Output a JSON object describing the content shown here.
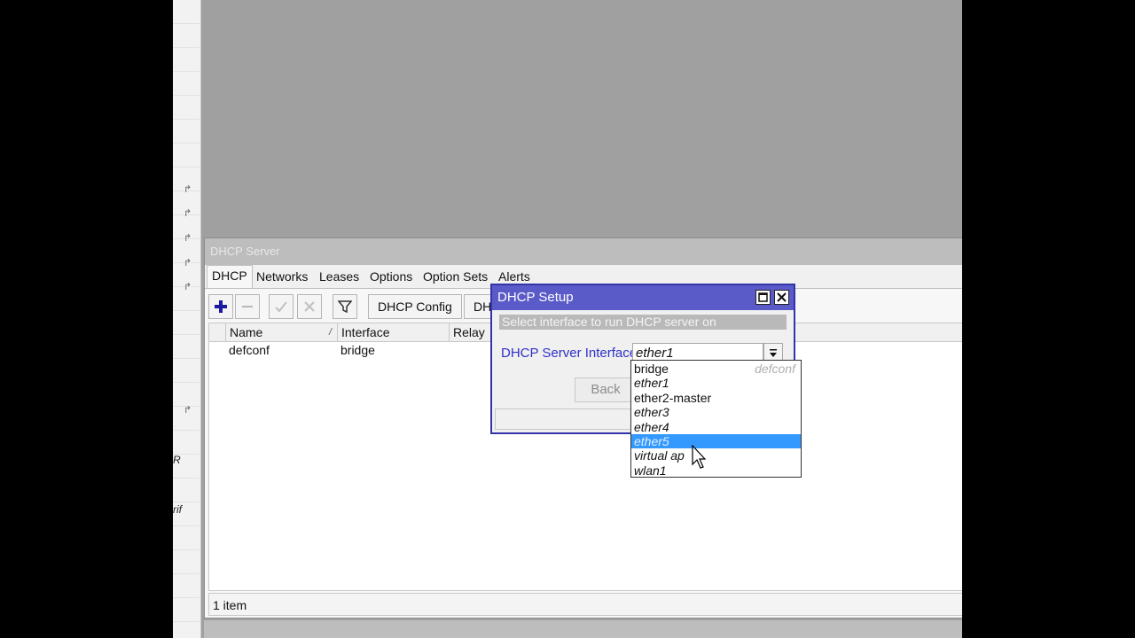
{
  "left_strip": {
    "flags": [
      "↱",
      "↱",
      "↱",
      "↱",
      "↱",
      "↱"
    ],
    "frag_1": "R",
    "frag_2": "rif"
  },
  "dhcp_window": {
    "title": "DHCP Server",
    "tabs": [
      "DHCP",
      "Networks",
      "Leases",
      "Options",
      "Option Sets",
      "Alerts"
    ],
    "toolbar": {
      "add_icon": "plus-icon",
      "remove_icon": "minus-icon",
      "enable_icon": "check-icon",
      "disable_icon": "cross-icon",
      "filter_icon": "filter-icon",
      "dhcp_config_label": "DHCP Config",
      "dhcp_setup_label": "DH"
    },
    "columns": [
      "Name",
      "Interface",
      "Relay"
    ],
    "sort_indicator": "/",
    "rows": [
      {
        "name": "defconf",
        "interface": "bridge",
        "relay": ""
      }
    ],
    "status": "1 item"
  },
  "setup_dialog": {
    "title": "DHCP Setup",
    "maximize_icon": "maximize-icon",
    "close_icon": "close-icon",
    "instruction": "Select interface to run DHCP server on",
    "field_label": "DHCP Server Interface:",
    "field_value": "ether1",
    "dropdown_icon": "chevron-down-icon",
    "back_label": "Back"
  },
  "dropdown": {
    "options": [
      {
        "label": "bridge",
        "note": "defconf",
        "italic": false,
        "selected": false
      },
      {
        "label": "ether1",
        "note": "",
        "italic": true,
        "selected": false
      },
      {
        "label": "ether2-master",
        "note": "",
        "italic": false,
        "selected": false
      },
      {
        "label": "ether3",
        "note": "",
        "italic": true,
        "selected": false
      },
      {
        "label": "ether4",
        "note": "",
        "italic": true,
        "selected": false
      },
      {
        "label": "ether5",
        "note": "",
        "italic": true,
        "selected": true
      },
      {
        "label": "virtual ap",
        "note": "",
        "italic": true,
        "selected": false
      },
      {
        "label": "wlan1",
        "note": "",
        "italic": true,
        "selected": false
      }
    ],
    "selection_color": "#3399ff"
  },
  "colors": {
    "dialog_title_bg": "#5a5ac8",
    "label_blue": "#3030c8",
    "add_icon_color": "#1a1aa0"
  }
}
